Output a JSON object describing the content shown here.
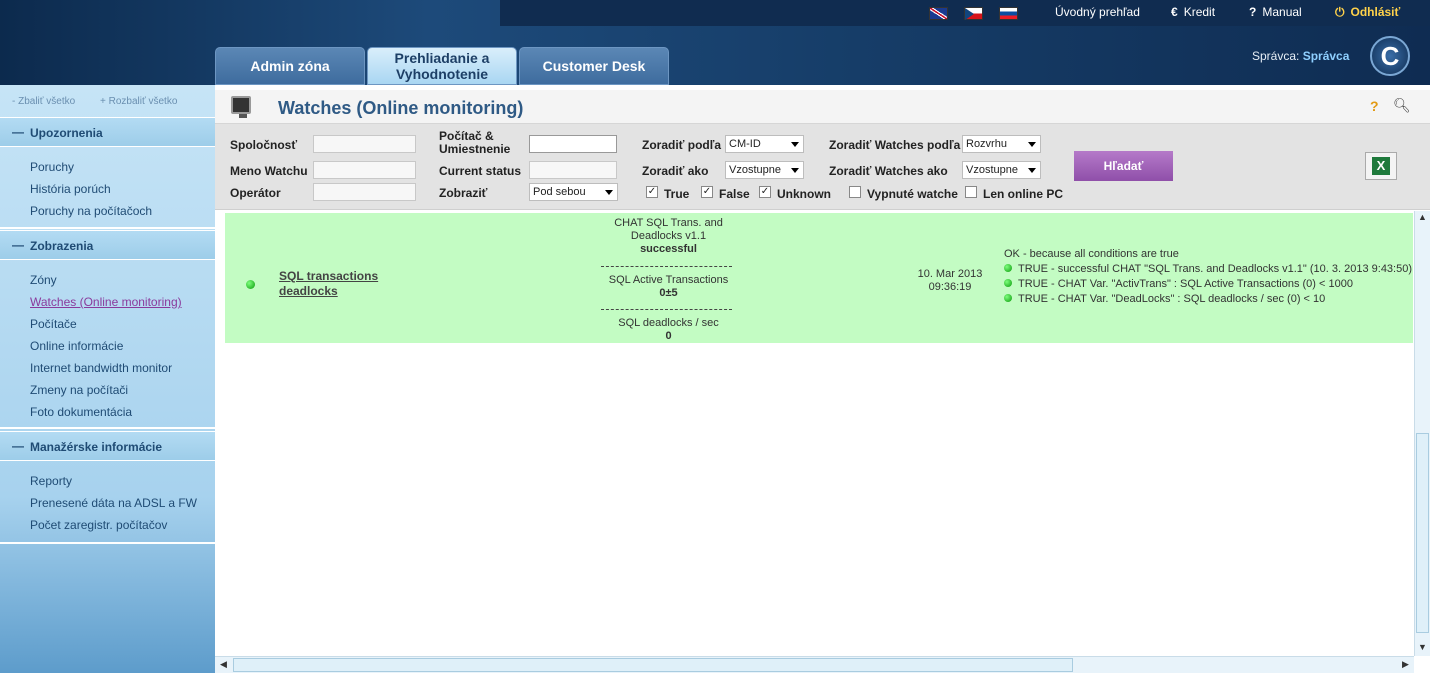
{
  "header": {
    "links": {
      "overview": "Úvodný prehľad",
      "credit": "Kredit",
      "manual": "Manual",
      "logout": "Odhlásiť"
    },
    "icons": {
      "credit": "€",
      "manual": "?",
      "logout": "⏻"
    },
    "tabs": [
      "Admin zóna",
      "Prehliadanie a Vyhodnotenie",
      "Customer Desk"
    ],
    "admin_label": "Správca:",
    "admin_name": "Správca",
    "logo_letter": "C"
  },
  "sidebar": {
    "collapse": "- Zbaliť všetko",
    "expand": "+ Rozbaliť všetko",
    "sections": [
      {
        "title": "Upozornenia",
        "items": [
          "Poruchy",
          "História porúch",
          "Poruchy na počítačoch"
        ]
      },
      {
        "title": "Zobrazenia",
        "items": [
          "Zóny",
          "Watches (Online monitoring)",
          "Počítače",
          "Online informácie",
          "Internet bandwidth monitor",
          "Zmeny na počítači",
          "Foto dokumentácia"
        ]
      },
      {
        "title": "Manažérske informácie",
        "items": [
          "Reporty",
          "Prenesené dáta na ADSL a FW",
          "Počet zaregistr. počítačov"
        ]
      }
    ]
  },
  "page": {
    "title": "Watches (Online monitoring)"
  },
  "filters": {
    "company": "Spoločnosť",
    "watch_name": "Meno Watchu",
    "operator": "Operátor",
    "pc_location": "Počítač & Umiestnenie",
    "current_status": "Current status",
    "display": "Zobraziť",
    "display_value": "Pod sebou",
    "sort_by": "Zoradiť podľa",
    "sort_by_value": "CM-ID",
    "sort_as": "Zoradiť ako",
    "sort_as_value": "Vzostupne",
    "watch_sort_by": "Zoradiť Watches podľa",
    "watch_sort_by_value": "Rozvrhu",
    "watch_sort_as": "Zoradiť Watches ako",
    "watch_sort_as_value": "Vzostupne",
    "cb_true": "True",
    "cb_false": "False",
    "cb_unknown": "Unknown",
    "cb_disabled": "Vypnuté watche",
    "cb_online": "Len online PC",
    "search_button": "Hľadať"
  },
  "row": {
    "name": "SQL transactions deadlocks",
    "checks": [
      {
        "label": "CHAT SQL Trans. and Deadlocks v1.1",
        "value": "successful"
      },
      {
        "label": "SQL Active Transactions",
        "value": "0±5"
      },
      {
        "label": "SQL deadlocks / sec",
        "value": "0"
      }
    ],
    "date": "10. Mar 2013",
    "time": "09:36:19",
    "result_header": "OK - because all conditions are true",
    "result_lines": [
      "TRUE - successful CHAT \"SQL Trans. and Deadlocks v1.1\" (10. 3. 2013 9:43:50)",
      "TRUE - CHAT Var. \"ActivTrans\" : SQL Active Transactions (0) < 1000",
      "TRUE - CHAT Var. \"DeadLocks\" : SQL deadlocks / sec (0) < 10"
    ],
    "status_color": "#0a9a0a"
  }
}
